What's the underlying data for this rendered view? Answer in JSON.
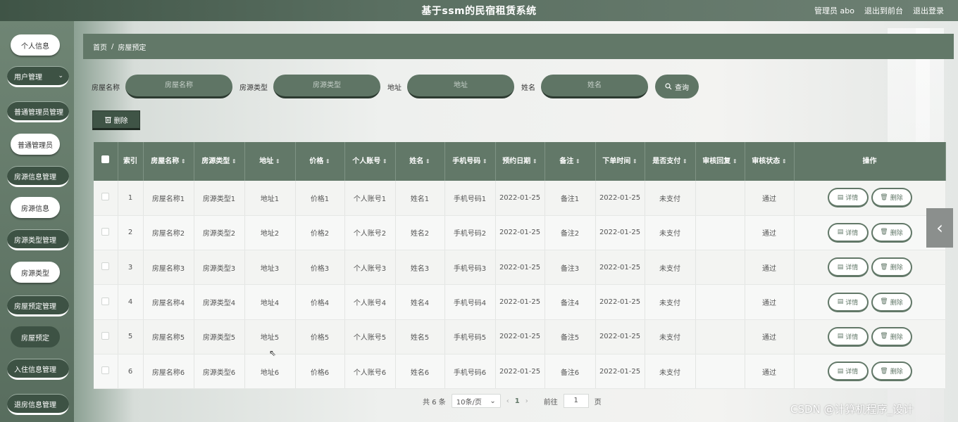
{
  "header": {
    "title": "基于ssm的民宿租赁系统",
    "user": "管理员 abo",
    "exit_front": "退出到前台",
    "logout": "退出登录"
  },
  "sidebar": {
    "items": [
      {
        "label": "个人信息",
        "kind": "white"
      },
      {
        "label": "用户管理",
        "kind": "dark",
        "chevron": "chevron-down-icon"
      },
      {
        "label": "普通管理员管理",
        "kind": "dark"
      },
      {
        "label": "普通管理员",
        "kind": "white"
      },
      {
        "label": "房源信息管理",
        "kind": "dark"
      },
      {
        "label": "房源信息",
        "kind": "white"
      },
      {
        "label": "房源类型管理",
        "kind": "dark"
      },
      {
        "label": "房源类型",
        "kind": "white"
      },
      {
        "label": "房屋预定管理",
        "kind": "dark"
      },
      {
        "label": "房屋预定",
        "kind": "active"
      },
      {
        "label": "入住信息管理",
        "kind": "dark"
      },
      {
        "label": "退房信息管理",
        "kind": "dark"
      }
    ]
  },
  "breadcrumb": {
    "home": "首页",
    "sep": "/",
    "current": "房屋预定"
  },
  "search": {
    "fields": [
      {
        "label": "房屋名称",
        "placeholder": "房屋名称"
      },
      {
        "label": "房源类型",
        "placeholder": "房源类型"
      },
      {
        "label": "地址",
        "placeholder": "地址"
      },
      {
        "label": "姓名",
        "placeholder": "姓名"
      }
    ],
    "query_label": "查询"
  },
  "toolbar": {
    "delete_label": "删除"
  },
  "table": {
    "columns": [
      {
        "label": "",
        "sortable": false
      },
      {
        "label": "索引",
        "sortable": false
      },
      {
        "label": "房屋名称",
        "sortable": true
      },
      {
        "label": "房源类型",
        "sortable": true
      },
      {
        "label": "地址",
        "sortable": true
      },
      {
        "label": "价格",
        "sortable": true
      },
      {
        "label": "个人账号",
        "sortable": true
      },
      {
        "label": "姓名",
        "sortable": true
      },
      {
        "label": "手机号码",
        "sortable": true
      },
      {
        "label": "预约日期",
        "sortable": true
      },
      {
        "label": "备注",
        "sortable": true
      },
      {
        "label": "下单时间",
        "sortable": true
      },
      {
        "label": "是否支付",
        "sortable": true
      },
      {
        "label": "审核回复",
        "sortable": true
      },
      {
        "label": "审核状态",
        "sortable": true
      },
      {
        "label": "操作",
        "sortable": false
      }
    ],
    "rows": [
      [
        "1",
        "房屋名称1",
        "房源类型1",
        "地址1",
        "价格1",
        "个人账号1",
        "姓名1",
        "手机号码1",
        "2022-01-25",
        "备注1",
        "2022-01-25",
        "未支付",
        "",
        "通过"
      ],
      [
        "2",
        "房屋名称2",
        "房源类型2",
        "地址2",
        "价格2",
        "个人账号2",
        "姓名2",
        "手机号码2",
        "2022-01-25",
        "备注2",
        "2022-01-25",
        "未支付",
        "",
        "通过"
      ],
      [
        "3",
        "房屋名称3",
        "房源类型3",
        "地址3",
        "价格3",
        "个人账号3",
        "姓名3",
        "手机号码3",
        "2022-01-25",
        "备注3",
        "2022-01-25",
        "未支付",
        "",
        "通过"
      ],
      [
        "4",
        "房屋名称4",
        "房源类型4",
        "地址4",
        "价格4",
        "个人账号4",
        "姓名4",
        "手机号码4",
        "2022-01-25",
        "备注4",
        "2022-01-25",
        "未支付",
        "",
        "通过"
      ],
      [
        "5",
        "房屋名称5",
        "房源类型5",
        "地址5",
        "价格5",
        "个人账号5",
        "姓名5",
        "手机号码5",
        "2022-01-25",
        "备注5",
        "2022-01-25",
        "未支付",
        "",
        "通过"
      ],
      [
        "6",
        "房屋名称6",
        "房源类型6",
        "地址6",
        "价格6",
        "个人账号6",
        "姓名6",
        "手机号码6",
        "2022-01-25",
        "备注6",
        "2022-01-25",
        "未支付",
        "",
        "通过"
      ]
    ],
    "detail_label": "详情",
    "row_delete_label": "删除"
  },
  "pagination": {
    "total": "共 6 条",
    "page_size": "10条/页",
    "current_page": "1",
    "goto_label": "前往",
    "goto_value": "1",
    "page_suffix": "页"
  },
  "watermark": "CSDN @计算机程序_设计",
  "icons": {
    "search": "search-icon",
    "trash": "trash-icon",
    "doc": "document-icon",
    "side": "chevron-left-icon"
  },
  "colors": {
    "primary": "#627868",
    "dark": "#3f5446",
    "accent": "#5f7565"
  }
}
